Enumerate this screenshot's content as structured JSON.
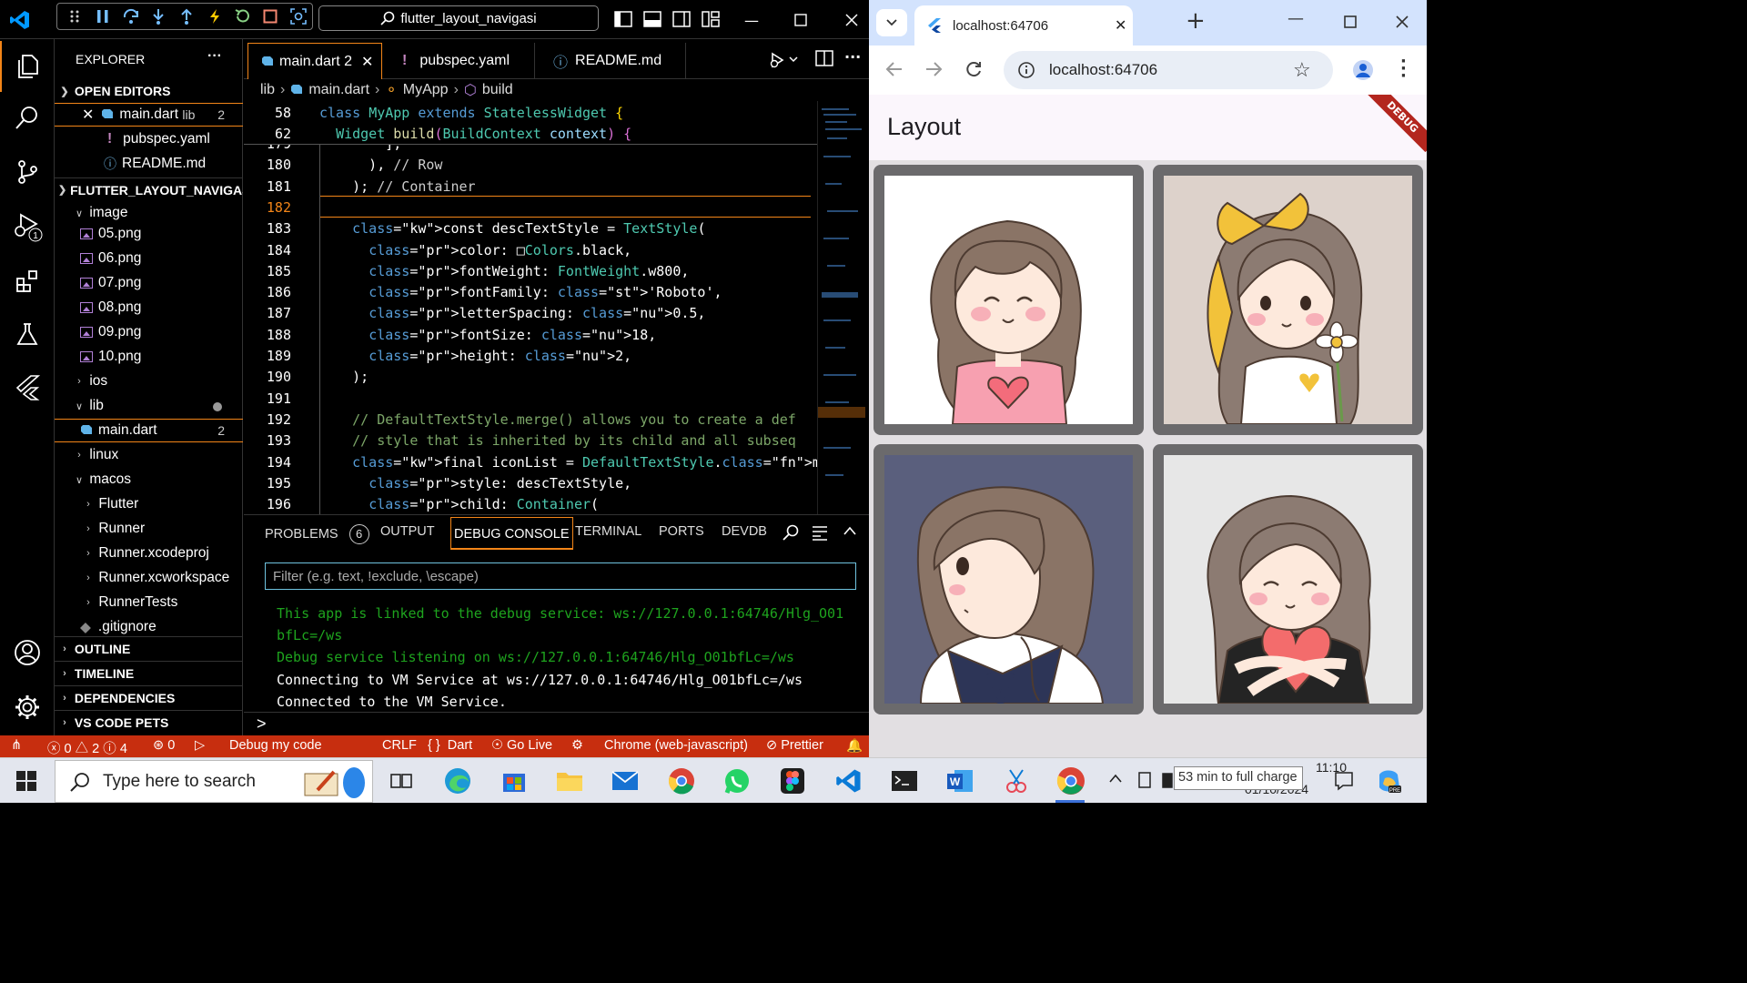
{
  "vscode": {
    "command_center": "flutter_layout_navigasi",
    "activity": [
      "explorer-icon",
      "search-icon",
      "source-control-icon",
      "run-debug-icon",
      "extensions-icon",
      "testing-icon",
      "flutter-icon",
      "accounts-icon",
      "settings-icon"
    ],
    "run_debug_badge": "1",
    "sidebar": {
      "title": "EXPLORER",
      "more": "···",
      "open_editors_header": "OPEN EDITORS",
      "open_editors": [
        {
          "name": "main.dart",
          "hint": "lib",
          "badge": "2"
        },
        {
          "name": "pubspec.yaml"
        },
        {
          "name": "README.md"
        }
      ],
      "project_header": "FLUTTER_LAYOUT_NAVIGASI",
      "tree": {
        "image": "image",
        "images": [
          "05.png",
          "06.png",
          "07.png",
          "08.png",
          "09.png",
          "10.png"
        ],
        "ios": "ios",
        "lib": "lib",
        "main": "main.dart",
        "main_badge": "2",
        "linux": "linux",
        "macos": "macos",
        "macos_children": [
          "Flutter",
          "Runner",
          "Runner.xcodeproj",
          "Runner.xcworkspace",
          "RunnerTests"
        ],
        "gitignore": ".gitignore"
      },
      "sections": [
        "OUTLINE",
        "TIMELINE",
        "DEPENDENCIES",
        "VS CODE PETS"
      ]
    },
    "tabs": [
      {
        "label": "main.dart 2",
        "icon": "dart-icon"
      },
      {
        "label": "pubspec.yaml",
        "icon": "exclaim-icon"
      },
      {
        "label": "README.md",
        "icon": "info-icon"
      }
    ],
    "breadcrumb": [
      "lib",
      "main.dart",
      "MyApp",
      "build"
    ],
    "sticky": [
      {
        "n": "58",
        "text": "class MyApp extends StatelessWidget {"
      },
      {
        "n": "62",
        "text": "  Widget build(BuildContext context) {"
      }
    ],
    "lines": [
      {
        "n": "179",
        "t": "        ],"
      },
      {
        "n": "180",
        "t": "      ), // Row"
      },
      {
        "n": "181",
        "t": "    ); // Container"
      },
      {
        "n": "182",
        "t": ""
      },
      {
        "n": "183",
        "t": "    const descTextStyle = TextStyle("
      },
      {
        "n": "184",
        "t": "      color: □Colors.black,"
      },
      {
        "n": "185",
        "t": "      fontWeight: FontWeight.w800,"
      },
      {
        "n": "186",
        "t": "      fontFamily: 'Roboto',"
      },
      {
        "n": "187",
        "t": "      letterSpacing: 0.5,"
      },
      {
        "n": "188",
        "t": "      fontSize: 18,"
      },
      {
        "n": "189",
        "t": "      height: 2,"
      },
      {
        "n": "190",
        "t": "    );"
      },
      {
        "n": "191",
        "t": ""
      },
      {
        "n": "192",
        "t": "    // DefaultTextStyle.merge() allows you to create a def"
      },
      {
        "n": "193",
        "t": "    // style that is inherited by its child and all subseq"
      },
      {
        "n": "194",
        "t": "    final iconList = DefaultTextStyle.merge("
      },
      {
        "n": "195",
        "t": "      style: descTextStyle,"
      },
      {
        "n": "196",
        "t": "      child: Container("
      }
    ],
    "panel": {
      "tabs": [
        "PROBLEMS",
        "OUTPUT",
        "DEBUG CONSOLE",
        "TERMINAL",
        "PORTS",
        "DEVDB"
      ],
      "problems_count": "6",
      "filter_placeholder": "Filter (e.g. text, !exclude, \\escape)",
      "console": [
        "This app is linked to the debug service: ws://127.0.0.1:64746/Hlg_O01",
        "bfLc=/ws",
        "Debug service listening on ws://127.0.0.1:64746/Hlg_O01bfLc=/ws",
        "Connecting to VM Service at ws://127.0.0.1:64746/Hlg_O01bfLc=/ws",
        "Connected to the VM Service."
      ],
      "prompt": ">"
    },
    "status": {
      "errors": "0",
      "warnings": "2",
      "infos": "4",
      "ports": "0",
      "debug": "Debug my code",
      "eol": "CRLF",
      "lang": "Dart",
      "golive": "Go Live",
      "device": "Chrome (web-javascript)",
      "prettier": "Prettier"
    },
    "colors": {
      "accent": "#f38518",
      "status": "#c72e0f"
    }
  },
  "chrome": {
    "tab_title": "localhost:64706",
    "url": "localhost:64706",
    "app_title": "Layout",
    "debug_banner": "DEBUG",
    "images": [
      "girl-pink-shirt-heart",
      "girl-yellow-bow-flower",
      "girl-sailor-uniform",
      "girl-hugging-heart"
    ]
  },
  "taskbar": {
    "search_placeholder": "Type here to search",
    "apps": [
      "task-view-icon",
      "edge-icon",
      "store-icon",
      "file-explorer-icon",
      "mail-icon",
      "chrome-alt-icon",
      "whatsapp-icon",
      "figma-icon",
      "vscode-icon",
      "terminal-icon",
      "word-icon",
      "snipping-icon",
      "chrome-icon"
    ],
    "tooltip": "53 min to full charge",
    "time": "11:10",
    "date": "01/10/2024"
  }
}
